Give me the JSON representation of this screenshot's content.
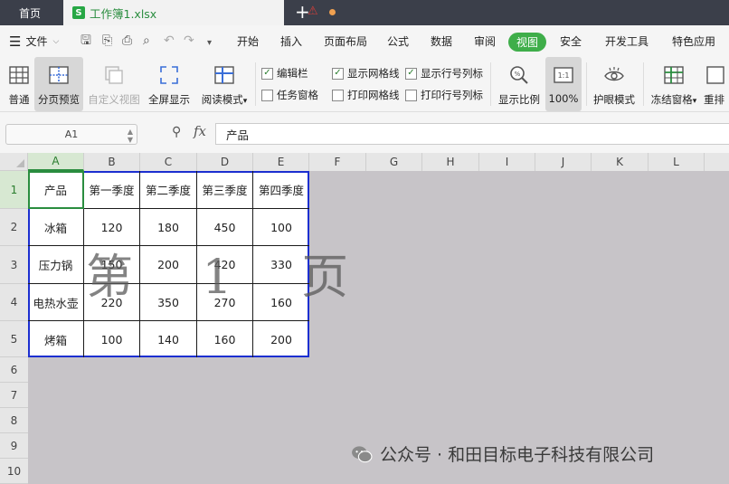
{
  "tabs": {
    "home": "首页",
    "file": "工作簿1.xlsx",
    "plus": "+"
  },
  "menu": {
    "file": "文件",
    "items": [
      "开始",
      "插入",
      "页面布局",
      "公式",
      "数据",
      "审阅",
      "视图",
      "安全",
      "开发工具",
      "特色应用"
    ],
    "active": "视图"
  },
  "ribbon": {
    "normal": "普通",
    "page_preview": "分页预览",
    "custom_view": "自定义视图",
    "fullscreen": "全屏显示",
    "reading_mode": "阅读模式",
    "checks": [
      {
        "label": "编辑栏",
        "checked": true
      },
      {
        "label": "任务窗格",
        "checked": false
      },
      {
        "label": "显示网格线",
        "checked": true
      },
      {
        "label": "打印网格线",
        "checked": false
      },
      {
        "label": "显示行号列标",
        "checked": true
      },
      {
        "label": "打印行号列标",
        "checked": false
      }
    ],
    "zoom_ratio": "显示比例",
    "zoom_100": "100%",
    "eye_mode": "护眼模式",
    "freeze": "冻结窗格",
    "rearrange": "重排"
  },
  "formula_bar": {
    "cell_ref": "A1",
    "fx": "fx",
    "content": "产品"
  },
  "grid": {
    "columns": [
      "A",
      "B",
      "C",
      "D",
      "E",
      "F",
      "G",
      "H",
      "I",
      "J",
      "K",
      "L"
    ],
    "rows": [
      "1",
      "2",
      "3",
      "4",
      "5",
      "6",
      "7",
      "8",
      "9",
      "10"
    ],
    "table": [
      [
        "产品",
        "第一季度",
        "第二季度",
        "第三季度",
        "第四季度"
      ],
      [
        "冰箱",
        "120",
        "180",
        "450",
        "100"
      ],
      [
        "压力锅",
        "150",
        "200",
        "420",
        "330"
      ],
      [
        "电热水壶",
        "220",
        "350",
        "270",
        "160"
      ],
      [
        "烤箱",
        "100",
        "140",
        "160",
        "200"
      ]
    ],
    "page_watermark": "第 1 页"
  },
  "watermark": "公众号 · 和田目标电子科技有限公司"
}
